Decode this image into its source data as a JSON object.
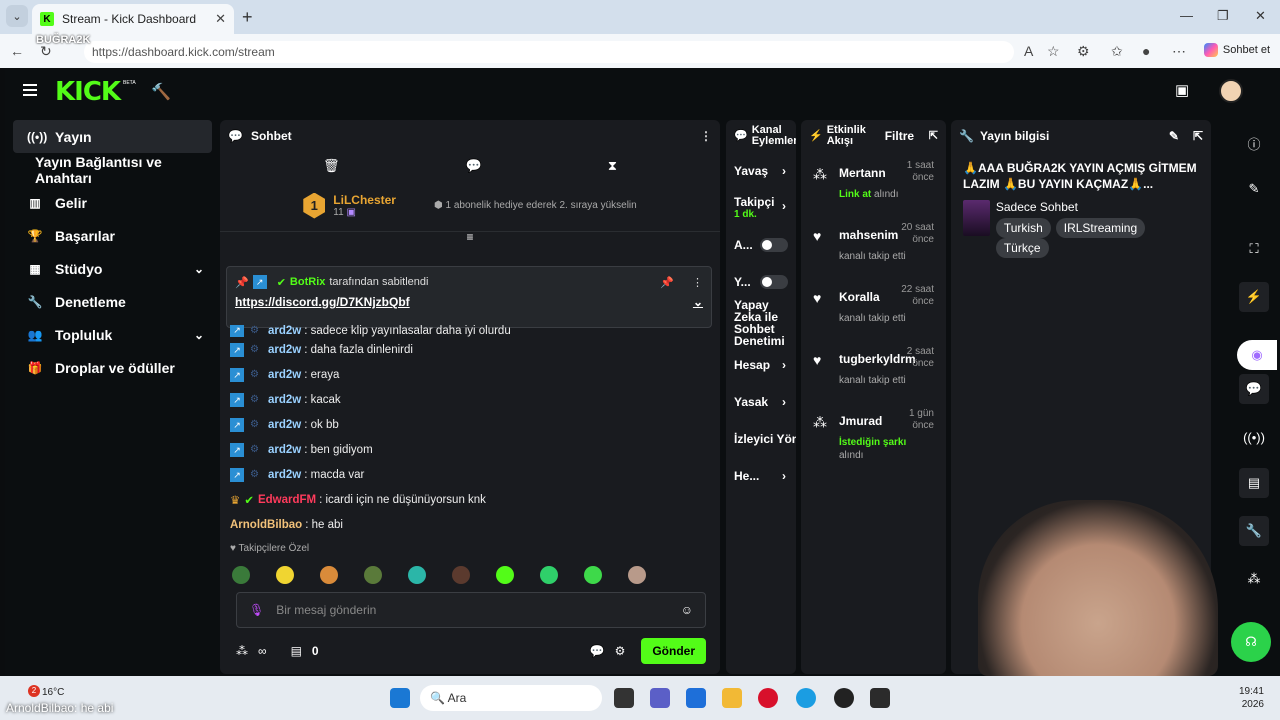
{
  "browser": {
    "tab_title": "Stream - Kick Dashboard",
    "url": "https://dashboard.kick.com/stream",
    "chat_button": "Sohbet et",
    "tiktok": "BUĞRA2K"
  },
  "app": {
    "logo": "KICK",
    "beta": "BETA"
  },
  "sidebar": {
    "items": [
      {
        "label": "Yayın",
        "icon": "broadcast-icon"
      },
      {
        "label": "Yayın Bağlantısı ve Anahtarı",
        "icon": ""
      },
      {
        "label": "Gelir",
        "icon": "chart-icon"
      },
      {
        "label": "Başarılar",
        "icon": "trophy-icon"
      },
      {
        "label": "Stüdyo",
        "icon": "grid-icon"
      },
      {
        "label": "Denetleme",
        "icon": "wrench-icon"
      },
      {
        "label": "Topluluk",
        "icon": "people-icon"
      },
      {
        "label": "Droplar ve ödüller",
        "icon": "gift-icon"
      }
    ]
  },
  "chat": {
    "title": "Sohbet",
    "sub_user": "LiLChester",
    "sub_count": "11",
    "sub_text": "1 abonelik hediye ederek 2. sıraya yükselin",
    "pinned_by": "BotRix",
    "pinned_suffix": "tarafından sabitlendi",
    "pinned_link": "https://discord.gg/D7KNjzbQbf",
    "messages": [
      {
        "user": "ard2w",
        "text": "sadece klip yayınlasalar daha iyi olurdu"
      },
      {
        "user": "ard2w",
        "text": "daha fazla dinlenirdi"
      },
      {
        "user": "ard2w",
        "text": "eraya"
      },
      {
        "user": "ard2w",
        "text": "kacak"
      },
      {
        "user": "ard2w",
        "text": "ok bb"
      },
      {
        "user": "ard2w",
        "text": "ben gidiyom"
      },
      {
        "user": "ard2w",
        "text": "macda var"
      },
      {
        "user": "EdwardFM",
        "text": "icardi için ne düşünüyorsun knk"
      },
      {
        "user": "ArnoldBilbao",
        "text": "he abi"
      }
    ],
    "followers_only": "Takipçilere Özel",
    "placeholder": "Bir mesaj gönderin",
    "points": "∞",
    "gifts": "0",
    "send": "Gönder"
  },
  "channel_actions": {
    "title": "Kanal Eylemleri",
    "rows": [
      {
        "label": "Yavaş",
        "sub": ""
      },
      {
        "label": "Takipçi",
        "sub": "1 dk."
      },
      {
        "label": "A...",
        "sub": ""
      },
      {
        "label": "Y...",
        "sub": ""
      },
      {
        "label": "Yapay Zeka ile Sohbet Denetimi",
        "sub": ""
      },
      {
        "label": "Hesap",
        "sub": ""
      },
      {
        "label": "Yasak",
        "sub": ""
      },
      {
        "label": "İzleyici Yön",
        "sub": ""
      },
      {
        "label": "He...",
        "sub": ""
      }
    ]
  },
  "activity": {
    "title": "Etkinlik Akışı",
    "filter": "Filtre",
    "items": [
      {
        "name": "Mertann",
        "time": "1 saat önce",
        "what": "alındı",
        "highlight": "Link at",
        "color": "#53fc18"
      },
      {
        "name": "mahsenim",
        "time": "20 saat önce",
        "what": "kanalı takip etti",
        "highlight": "",
        "color": ""
      },
      {
        "name": "Koralla",
        "time": "22 saat önce",
        "what": "kanalı takip etti",
        "highlight": "",
        "color": ""
      },
      {
        "name": "tugberkyldrm",
        "time": "2 saat önce",
        "what": "kanalı takip etti",
        "highlight": "",
        "color": ""
      },
      {
        "name": "Jmurad",
        "time": "1 gün önce",
        "what": "alındı",
        "highlight": "İstediğin şarkı",
        "color": "#53fc18"
      }
    ]
  },
  "stream_info": {
    "title": "Yayın bilgisi",
    "stream_title": "🙏AAA BUĞRA2K YAYIN AÇMIŞ GİTMEM LAZIM 🙏BU YAYIN KAÇMAZ🙏...",
    "category": "Sadece Sohbet",
    "tags": [
      "Turkish",
      "IRLStreaming",
      "Türkçe"
    ]
  },
  "taskbar": {
    "weather": "16°C",
    "search": "Ara",
    "time": "19:41",
    "date": "2026",
    "notif": "2",
    "overlay": "ArnoldBilbao: he abi"
  }
}
